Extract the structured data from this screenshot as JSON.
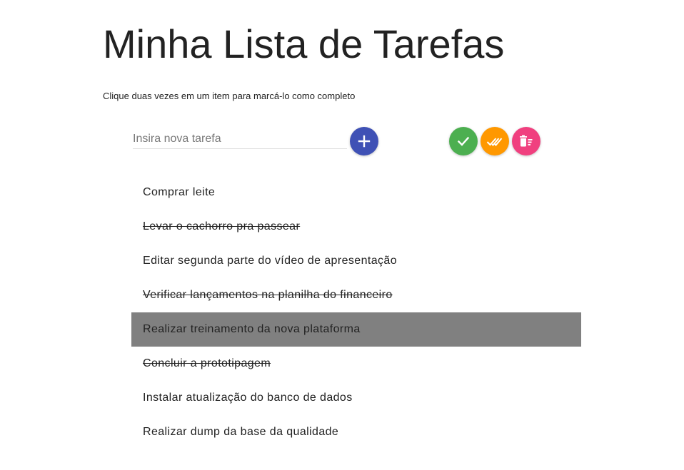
{
  "header": {
    "title": "Minha Lista de Tarefas",
    "subtitle": "Clique duas vezes em um item para marcá-lo como completo"
  },
  "input": {
    "placeholder": "Insira nova tarefa",
    "value": ""
  },
  "buttons": {
    "add": {
      "icon": "plus-icon",
      "color": "#3f51b5"
    },
    "complete": {
      "icon": "check-icon",
      "color": "#4caf50"
    },
    "complete_all": {
      "icon": "double-check-icon",
      "color": "#ff9800"
    },
    "delete_completed": {
      "icon": "delete-sweep-icon",
      "color": "#f0407f"
    }
  },
  "selected_color": "#808080",
  "tasks": [
    {
      "label": "Comprar leite",
      "done": false,
      "selected": false
    },
    {
      "label": "Levar o cachorro pra passear",
      "done": true,
      "selected": false
    },
    {
      "label": "Editar segunda parte do vídeo de apresentação",
      "done": false,
      "selected": false
    },
    {
      "label": "Verificar lançamentos na planilha do financeiro",
      "done": true,
      "selected": false
    },
    {
      "label": "Realizar treinamento da nova plataforma",
      "done": false,
      "selected": true
    },
    {
      "label": "Concluir a prototipagem",
      "done": true,
      "selected": false
    },
    {
      "label": "Instalar atualização do banco de dados",
      "done": false,
      "selected": false
    },
    {
      "label": "Realizar dump da base da qualidade",
      "done": false,
      "selected": false
    }
  ]
}
